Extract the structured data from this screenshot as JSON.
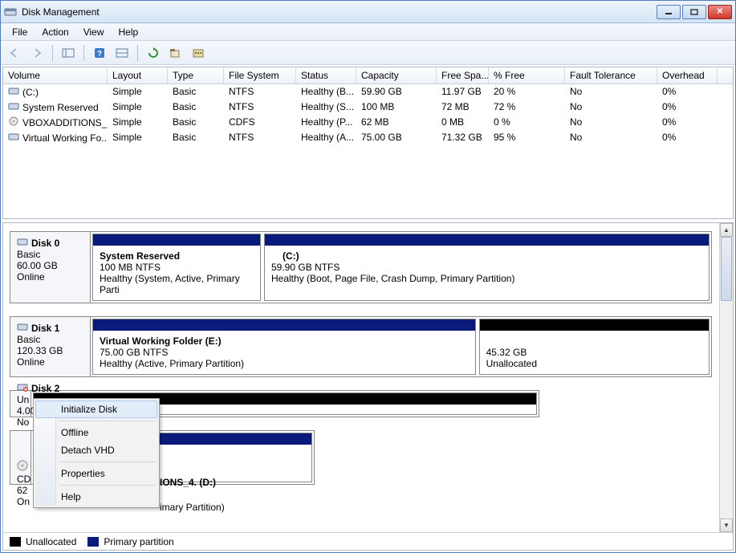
{
  "window": {
    "title": "Disk Management"
  },
  "menu": {
    "file": "File",
    "action": "Action",
    "view": "View",
    "help": "Help"
  },
  "columns": {
    "volume": "Volume",
    "layout": "Layout",
    "type": "Type",
    "filesystem": "File System",
    "status": "Status",
    "capacity": "Capacity",
    "freespace": "Free Spa...",
    "pctfree": "% Free",
    "fault": "Fault Tolerance",
    "overhead": "Overhead"
  },
  "volumes": [
    {
      "name": "(C:)",
      "layout": "Simple",
      "type": "Basic",
      "fs": "NTFS",
      "status": "Healthy (B...",
      "capacity": "59.90 GB",
      "free": "11.97 GB",
      "pct": "20 %",
      "fault": "No",
      "oh": "0%",
      "icon": "hd"
    },
    {
      "name": "System Reserved",
      "layout": "Simple",
      "type": "Basic",
      "fs": "NTFS",
      "status": "Healthy (S...",
      "capacity": "100 MB",
      "free": "72 MB",
      "pct": "72 %",
      "fault": "No",
      "oh": "0%",
      "icon": "hd"
    },
    {
      "name": "VBOXADDITIONS_...",
      "layout": "Simple",
      "type": "Basic",
      "fs": "CDFS",
      "status": "Healthy (P...",
      "capacity": "62 MB",
      "free": "0 MB",
      "pct": "0 %",
      "fault": "No",
      "oh": "0%",
      "icon": "cd"
    },
    {
      "name": "Virtual Working Fo...",
      "layout": "Simple",
      "type": "Basic",
      "fs": "NTFS",
      "status": "Healthy (A...",
      "capacity": "75.00 GB",
      "free": "71.32 GB",
      "pct": "95 %",
      "fault": "No",
      "oh": "0%",
      "icon": "hd"
    }
  ],
  "disks": {
    "d0": {
      "title": "Disk 0",
      "type": "Basic",
      "size": "60.00 GB",
      "state": "Online",
      "parts": [
        {
          "title": "System Reserved",
          "line2": "100 MB NTFS",
          "line3": "Healthy (System, Active, Primary Parti"
        },
        {
          "title": "(C:)",
          "line2": "59.90 GB NTFS",
          "line3": "Healthy (Boot, Page File, Crash Dump, Primary Partition)"
        }
      ]
    },
    "d1": {
      "title": "Disk 1",
      "type": "Basic",
      "size": "120.33 GB",
      "state": "Online",
      "parts": [
        {
          "title": "Virtual Working Folder  (E:)",
          "line2": "75.00 GB NTFS",
          "line3": "Healthy (Active, Primary Partition)"
        }
      ],
      "unalloc": {
        "size": "45.32 GB",
        "label": "Unallocated"
      }
    },
    "d2": {
      "title": "Disk 2",
      "type": "Un",
      "size": "4.00",
      "state": "No"
    },
    "cd": {
      "title": "CD",
      "size": "62",
      "state": "On",
      "part": {
        "title": "IONS_4.  (D:)",
        "line3": "imary Partition)"
      }
    }
  },
  "legend": {
    "unallocated": "Unallocated",
    "primary": "Primary partition"
  },
  "ctx": {
    "initialize": "Initialize Disk",
    "offline": "Offline",
    "detach": "Detach VHD",
    "properties": "Properties",
    "help": "Help"
  }
}
